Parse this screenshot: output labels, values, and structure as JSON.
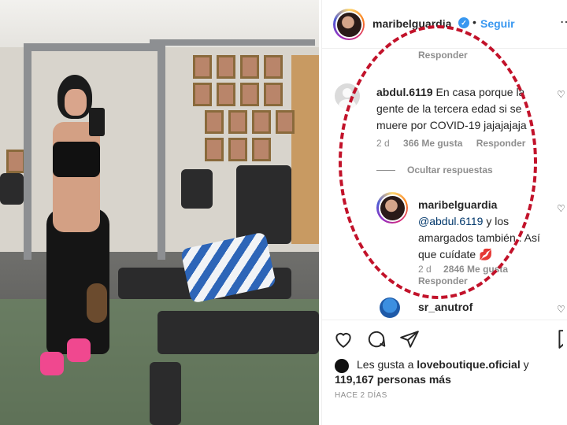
{
  "post": {
    "author": "maribelguardia",
    "follow_label": "Seguir",
    "separator": "•",
    "more_glyph": "⋯"
  },
  "comments": {
    "reply_top_label": "Responder",
    "first": {
      "username": "abdul.6119",
      "text": "En casa porque la gente de la tercera edad si se muere por COVID-19 jajajajaja",
      "time": "2 d",
      "likes": "366 Me gusta",
      "reply_label": "Responder"
    },
    "hide_replies_label": "Ocultar respuestas",
    "reply": {
      "username": "maribelguardia",
      "mention": "@abdul.6119",
      "text": " y los amargados también . Así que cuídate ",
      "emoji": "💋",
      "time": "2 d",
      "likes": "2846 Me gusta",
      "reply_label": "Responder"
    },
    "next": {
      "username": "sr_anutrof"
    }
  },
  "likes": {
    "prefix": "Les gusta a ",
    "user": "loveboutique.oficial",
    "connector": " y",
    "count": "119,167 personas más"
  },
  "date": "HACE 2 DÍAS",
  "colors": {
    "accent_blue": "#3897f0",
    "highlight_red": "#c2122a"
  },
  "icons": {
    "heart": "heart-icon",
    "comment": "comment-icon",
    "share": "share-icon",
    "save": "bookmark-icon",
    "verified": "verified-badge-icon"
  }
}
